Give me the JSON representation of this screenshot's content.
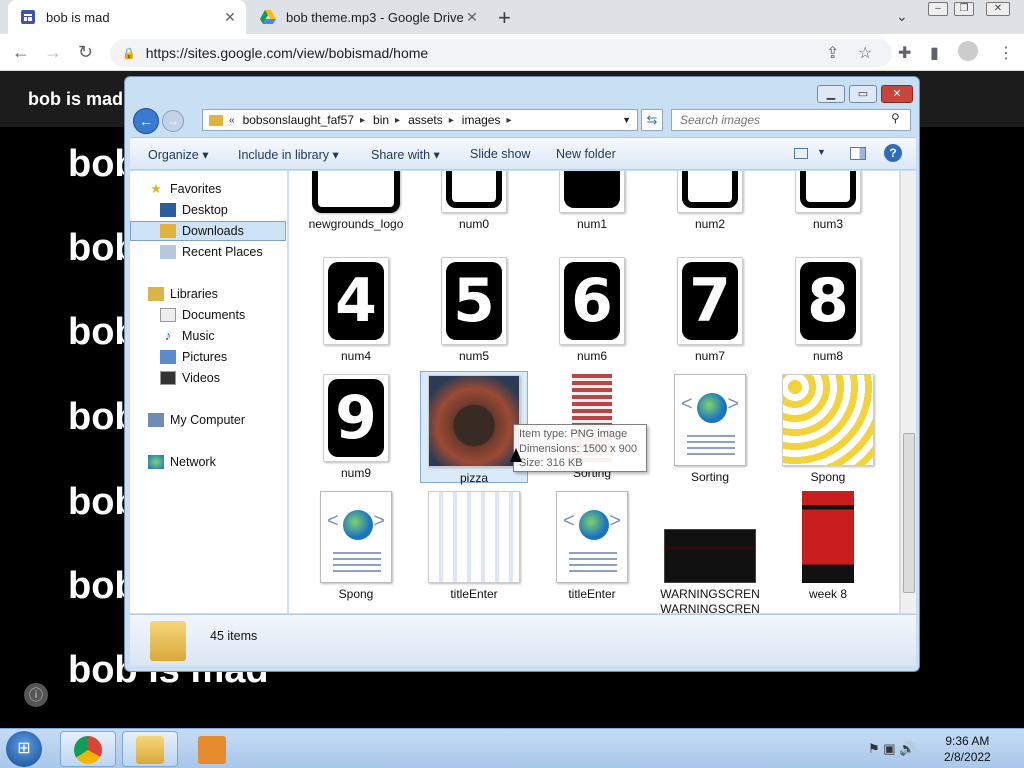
{
  "browser": {
    "tabs": [
      {
        "title": "bob is mad"
      },
      {
        "title": "bob theme.mp3 - Google Drive"
      }
    ],
    "url": "https://sites.google.com/view/bobismad/home",
    "new_tab": "+"
  },
  "site": {
    "header_title": "bob is mad",
    "lines": [
      "bob",
      "bob",
      "bob",
      "bob",
      "bob",
      "bob",
      "bob is mad"
    ]
  },
  "explorer": {
    "breadcrumbs": [
      "bobsonslaught_faf57",
      "bin",
      "assets",
      "images"
    ],
    "search_placeholder": "Search images",
    "toolbar": {
      "organize": "Organize",
      "include": "Include in library",
      "share": "Share with",
      "slideshow": "Slide show",
      "newfolder": "New folder"
    },
    "nav": {
      "favorites": "Favorites",
      "desktop": "Desktop",
      "downloads": "Downloads",
      "recent": "Recent Places",
      "libraries": "Libraries",
      "documents": "Documents",
      "music": "Music",
      "pictures": "Pictures",
      "videos": "Videos",
      "computer": "My Computer",
      "network": "Network"
    },
    "files": [
      {
        "name": "newgrounds_logo"
      },
      {
        "name": "num0"
      },
      {
        "name": "num1"
      },
      {
        "name": "num2"
      },
      {
        "name": "num3"
      },
      {
        "name": "num4",
        "glyph": "4"
      },
      {
        "name": "num5",
        "glyph": "5"
      },
      {
        "name": "num6",
        "glyph": "6"
      },
      {
        "name": "num7",
        "glyph": "7"
      },
      {
        "name": "num8",
        "glyph": "8"
      },
      {
        "name": "num9",
        "glyph": "9"
      },
      {
        "name": "pizza"
      },
      {
        "name": "Sorting"
      },
      {
        "name": "Sorting"
      },
      {
        "name": "Spong"
      },
      {
        "name": "Spong"
      },
      {
        "name": "titleEnter"
      },
      {
        "name": "titleEnter"
      },
      {
        "name": "WARNINGSCREN",
        "name2": "WARNINGSCREN"
      },
      {
        "name": "week 8"
      }
    ],
    "tooltip": {
      "type": "Item type: PNG image",
      "dims": "Dimensions: 1500 x 900",
      "size": "Size: 316 KB"
    },
    "status_count": "45 items"
  },
  "taskbar": {
    "time": "9:36 AM",
    "date": "2/8/2022"
  }
}
